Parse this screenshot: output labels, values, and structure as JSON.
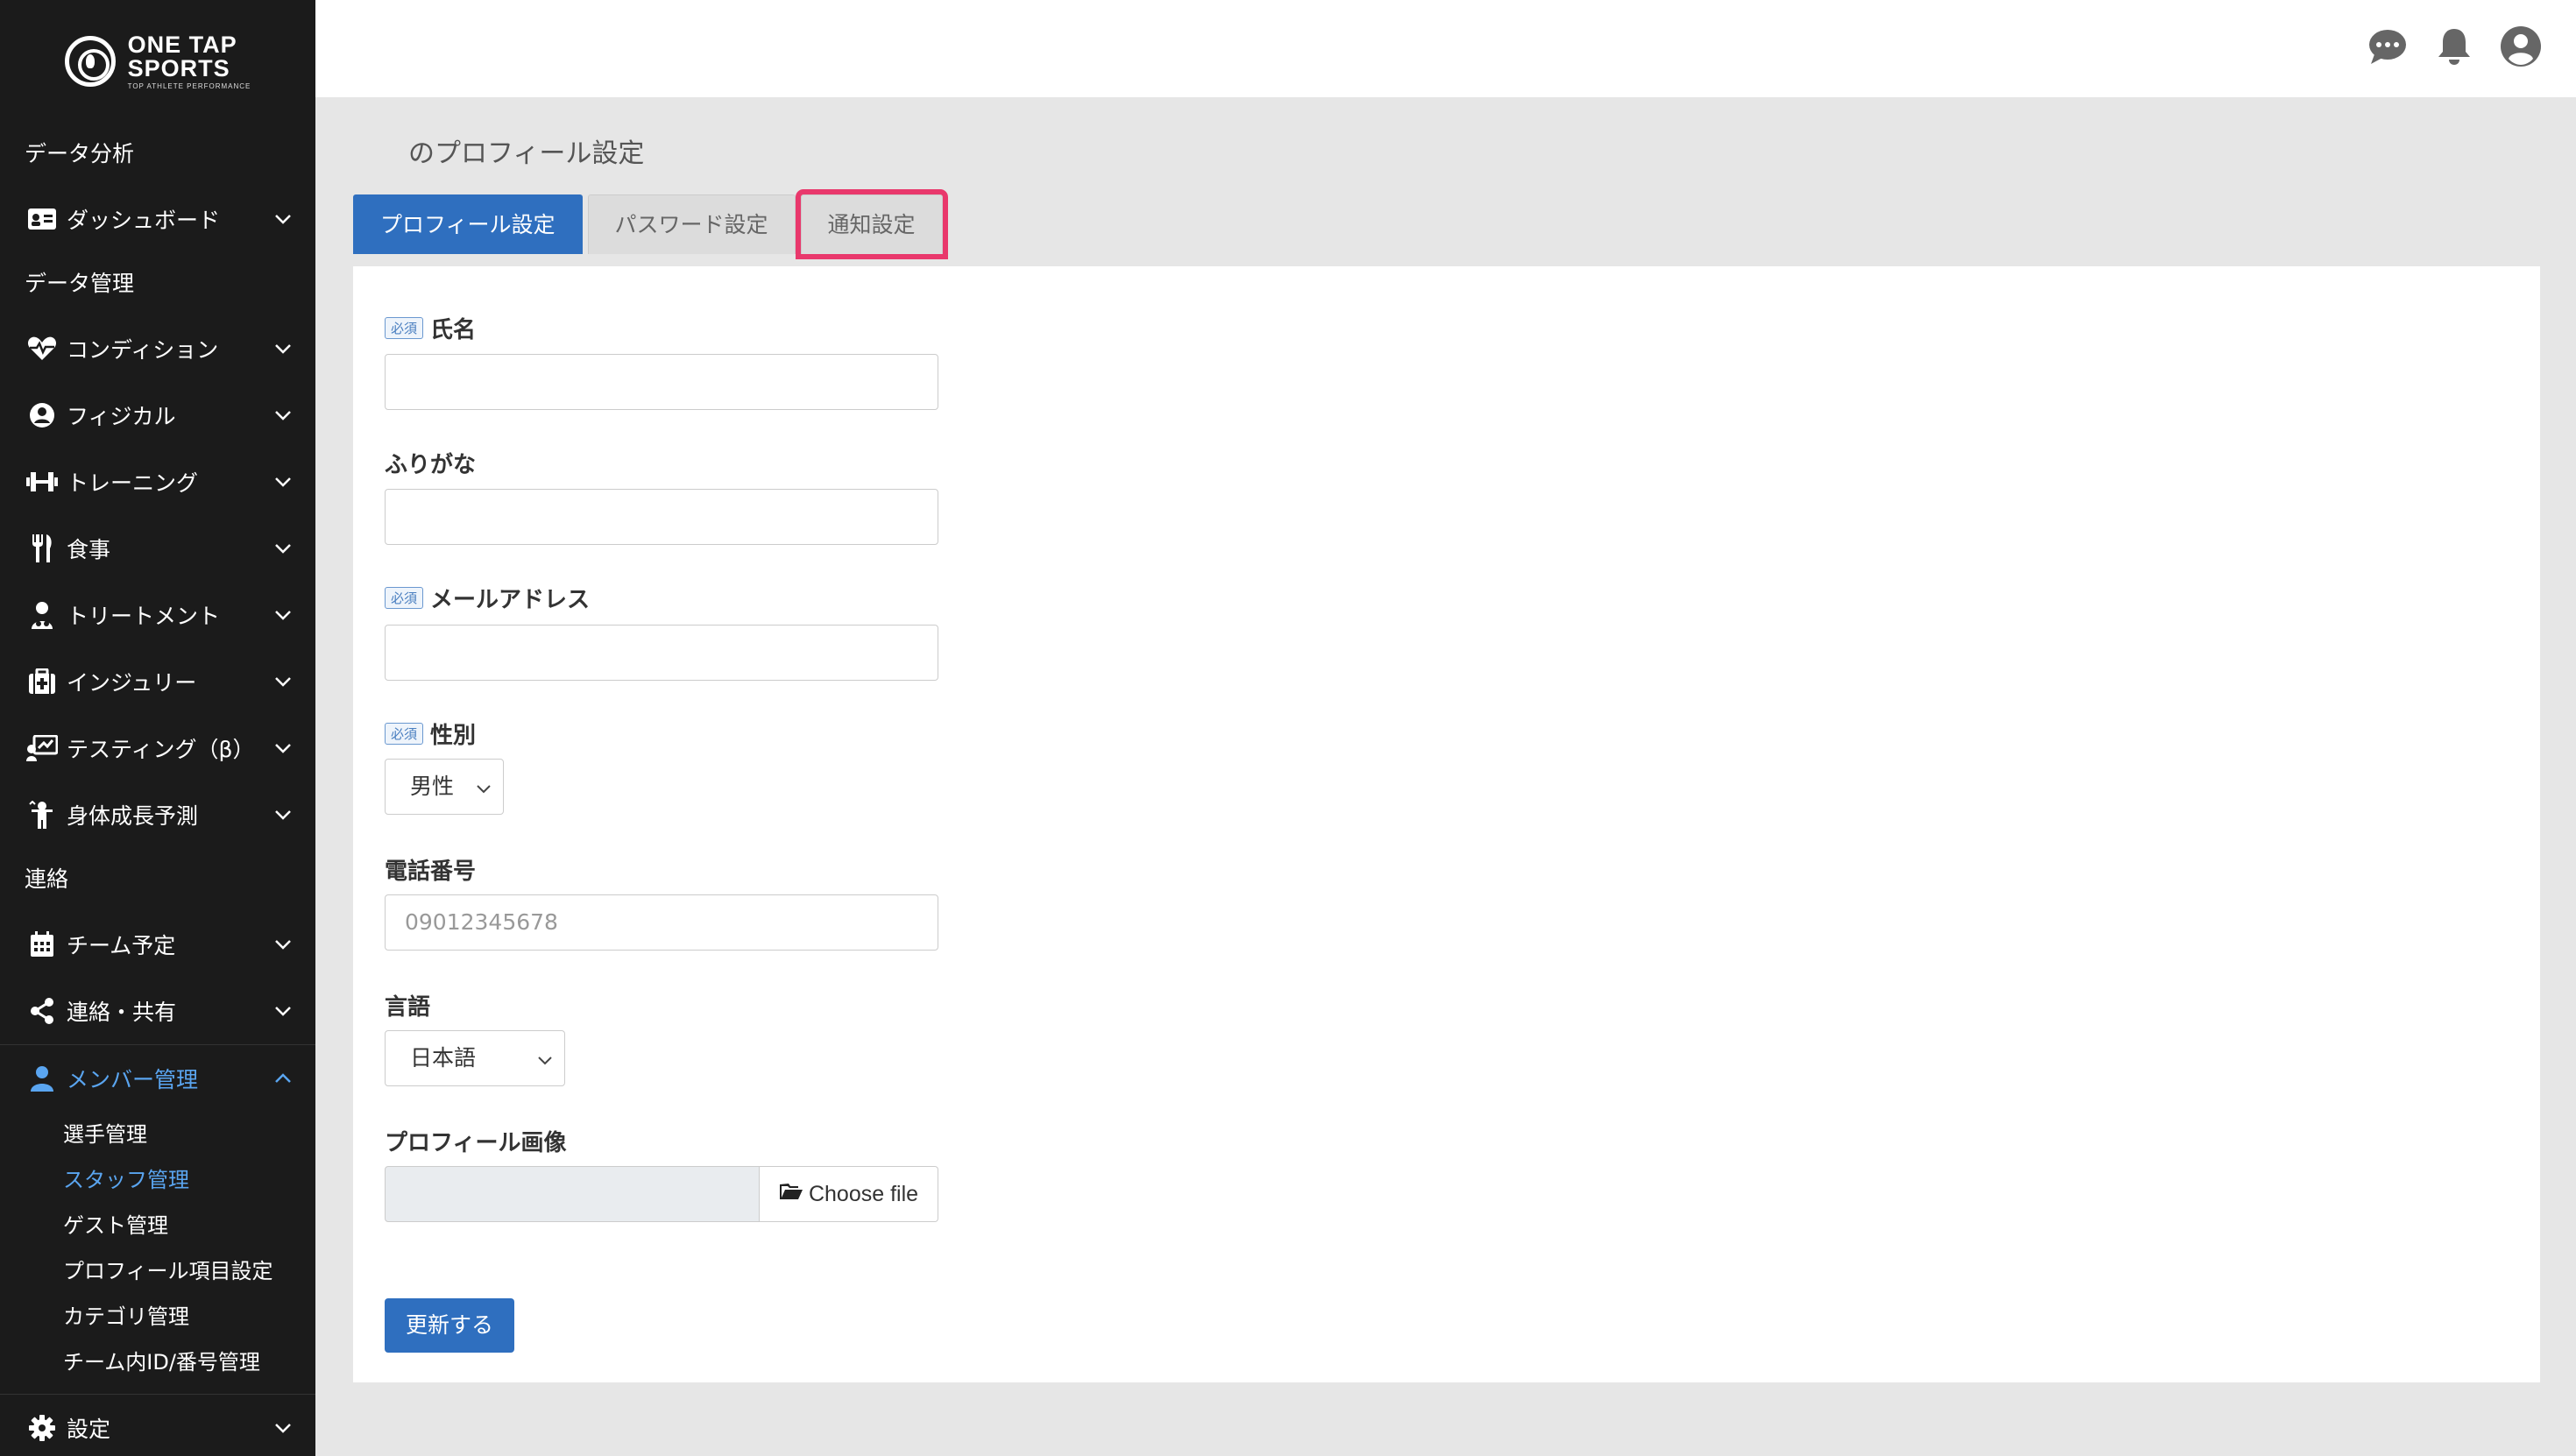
{
  "logo": {
    "line1": "ONE TAP",
    "line2": "SPORTS",
    "tagline": "TOP ATHLETE PERFORMANCE"
  },
  "sidebar": {
    "sections": {
      "analysis": "データ分析",
      "data_mgmt": "データ管理",
      "contact": "連絡"
    },
    "items": {
      "dashboard": "ダッシュボード",
      "condition": "コンディション",
      "physical": "フィジカル",
      "training": "トレーニング",
      "meal": "食事",
      "treatment": "トリートメント",
      "injury": "インジュリー",
      "testing": "テスティング（β）",
      "growth": "身体成長予測",
      "schedule": "チーム予定",
      "share": "連絡・共有",
      "member": "メンバー管理",
      "settings": "設定"
    },
    "sub_items": {
      "players": "選手管理",
      "staff": "スタッフ管理",
      "guest": "ゲスト管理",
      "profile_items": "プロフィール項目設定",
      "category": "カテゴリ管理",
      "team_id": "チーム内ID/番号管理"
    }
  },
  "header": {
    "title": "のプロフィール設定"
  },
  "tabs": {
    "profile": "プロフィール設定",
    "password": "パスワード設定",
    "notify": "通知設定"
  },
  "form": {
    "required_badge": "必須",
    "name_label": "氏名",
    "name_value": "",
    "furigana_label": "ふりがな",
    "furigana_value": "",
    "email_label": "メールアドレス",
    "email_value": "",
    "gender_label": "性別",
    "gender_value": "男性",
    "phone_label": "電話番号",
    "phone_placeholder": "09012345678",
    "language_label": "言語",
    "language_value": "日本語",
    "image_label": "プロフィール画像",
    "choose_file": "Choose file",
    "submit": "更新する"
  },
  "colors": {
    "sidebar_bg": "#1b1b1b",
    "accent": "#2f6fbf",
    "active_link": "#5aa5f0",
    "highlight": "#e9386c"
  }
}
